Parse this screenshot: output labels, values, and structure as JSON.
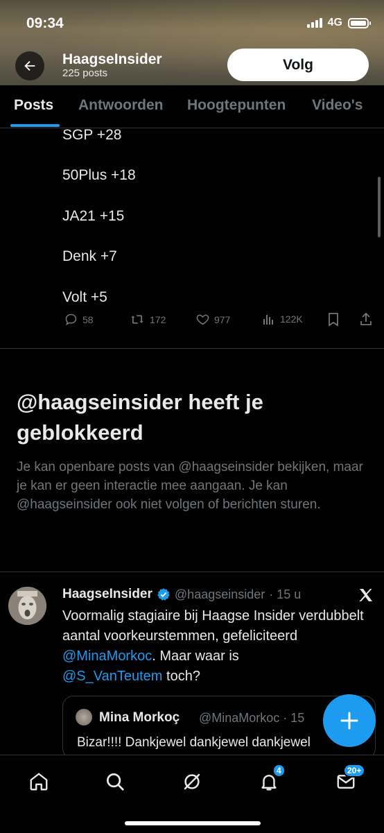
{
  "status_bar": {
    "time": "09:34",
    "network": "4G"
  },
  "header": {
    "name": "HaagseInsider",
    "post_count": "225 posts",
    "follow_label": "Volg"
  },
  "tabs": [
    {
      "label": "Posts",
      "active": true
    },
    {
      "label": "Antwoorden"
    },
    {
      "label": "Hoogtepunten"
    },
    {
      "label": "Video's"
    }
  ],
  "previous_post": {
    "lines": [
      "SGP +28",
      "50Plus +18",
      "JA21 +15",
      "Denk +7",
      "Volt +5"
    ],
    "actions": {
      "replies": "58",
      "reposts": "172",
      "likes": "977",
      "views": "122K"
    }
  },
  "blocked_notice": {
    "title": "@haagseinsider heeft je geblokkeerd",
    "text": "Je kan openbare posts van @haagseinsider bekijken, maar je kan er geen interactie mee aangaan. Je kan @haagseinsider ook niet volgen of berichten sturen."
  },
  "tweet": {
    "author": "HaagseInsider",
    "handle": "@haagseinsider",
    "time": "· 15 u",
    "text_1": "Voormalig stagiaire bij Haagse Insider verdubbelt aantal voorkeurstemmen, gefeliciteerd ",
    "mention_1": "@MinaMorkoc",
    "text_2": ". Maar waar is ",
    "mention_2": "@S_VanTeutem",
    "text_3": " toch?",
    "quote": {
      "name": "Mina Morkoç",
      "handle": "@MinaMorkoc · 15",
      "text": "Bizar!!!! Dankjewel dankjewel dankjewel"
    }
  },
  "bottom_nav": {
    "notifications_badge": "4",
    "messages_badge": "20+"
  },
  "colors": {
    "accent": "#1d9bf0",
    "background": "#000000",
    "muted": "#71767b"
  }
}
